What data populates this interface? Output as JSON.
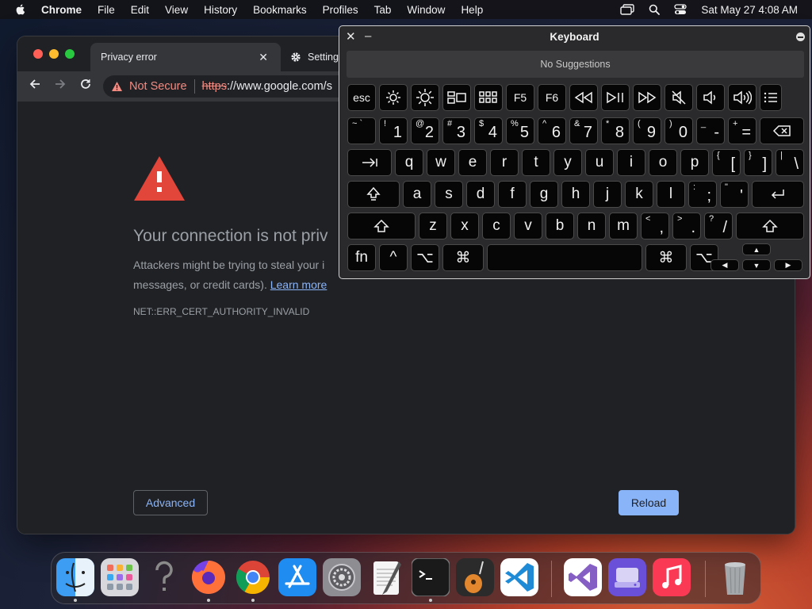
{
  "menubar": {
    "app": "Chrome",
    "items": [
      "File",
      "Edit",
      "View",
      "History",
      "Bookmarks",
      "Profiles",
      "Tab",
      "Window",
      "Help"
    ],
    "datetime": "Sat May 27  4:08 AM"
  },
  "browser": {
    "tab_active_title": "Privacy error",
    "tab_second_title": "Setting",
    "security_chip": "Not Secure",
    "url_scheme": "https",
    "url_rest": "://www.google.com/s"
  },
  "page": {
    "heading": "Your connection is not priv",
    "para_line1": "Attackers might be trying to steal your i",
    "para_line2": "messages, or credit cards).",
    "learn_more": "Learn more",
    "error_code": "NET::ERR_CERT_AUTHORITY_INVALID",
    "advanced_label": "Advanced",
    "reload_label": "Reload"
  },
  "keyboard_viewer": {
    "title": "Keyboard",
    "suggestions": "No Suggestions",
    "rows": [
      [
        {
          "n": "key-esc",
          "l": "esc",
          "w": 36,
          "c": "fnrow"
        },
        {
          "n": "key-brightness-down",
          "i": "sun-small",
          "w": 36
        },
        {
          "n": "key-brightness-up",
          "i": "sun-large",
          "w": 36
        },
        {
          "n": "key-mission-control",
          "i": "mission-control",
          "w": 36
        },
        {
          "n": "key-launchpad",
          "i": "launchpad",
          "w": 36
        },
        {
          "n": "key-f5",
          "l": "F5",
          "w": 36,
          "c": "fnrow"
        },
        {
          "n": "key-f6",
          "l": "F6",
          "w": 36,
          "c": "fnrow"
        },
        {
          "n": "key-rewind",
          "i": "rewind",
          "w": 36
        },
        {
          "n": "key-play-pause",
          "i": "play-pause",
          "w": 36
        },
        {
          "n": "key-fast-forward",
          "i": "fast-forward",
          "w": 36
        },
        {
          "n": "key-mute",
          "i": "mute",
          "w": 36
        },
        {
          "n": "key-volume-down",
          "i": "volume-down",
          "w": 36
        },
        {
          "n": "key-volume-up",
          "i": "volume-up",
          "w": 36
        },
        {
          "n": "key-list",
          "i": "list",
          "w": 28
        }
      ],
      [
        {
          "n": "key-backtick",
          "s": "~ `",
          "w": 36
        },
        {
          "n": "key-1",
          "s": "!",
          "m": "1",
          "w": 36
        },
        {
          "n": "key-2",
          "s": "@",
          "m": "2",
          "w": 36
        },
        {
          "n": "key-3",
          "s": "#",
          "m": "3",
          "w": 36
        },
        {
          "n": "key-4",
          "s": "$",
          "m": "4",
          "w": 36
        },
        {
          "n": "key-5",
          "s": "%",
          "m": "5",
          "w": 36
        },
        {
          "n": "key-6",
          "s": "^",
          "m": "6",
          "w": 36
        },
        {
          "n": "key-7",
          "s": "&",
          "m": "7",
          "w": 36
        },
        {
          "n": "key-8",
          "s": "*",
          "m": "8",
          "w": 36
        },
        {
          "n": "key-9",
          "s": "(",
          "m": "9",
          "w": 36
        },
        {
          "n": "key-0",
          "s": ")",
          "m": "0",
          "w": 36
        },
        {
          "n": "key-minus",
          "s": "_",
          "m": "-",
          "w": 36
        },
        {
          "n": "key-equals",
          "s": "+",
          "m": "=",
          "w": 36
        },
        {
          "n": "key-delete",
          "i": "delete",
          "w": 56
        }
      ],
      [
        {
          "n": "key-tab",
          "i": "tab",
          "w": 56
        },
        {
          "n": "key-q",
          "l": "q",
          "w": 36
        },
        {
          "n": "key-w",
          "l": "w",
          "w": 36
        },
        {
          "n": "key-e",
          "l": "e",
          "w": 36
        },
        {
          "n": "key-r",
          "l": "r",
          "w": 36
        },
        {
          "n": "key-t",
          "l": "t",
          "w": 36
        },
        {
          "n": "key-y",
          "l": "y",
          "w": 36
        },
        {
          "n": "key-u",
          "l": "u",
          "w": 36
        },
        {
          "n": "key-i",
          "l": "i",
          "w": 36
        },
        {
          "n": "key-o",
          "l": "o",
          "w": 36
        },
        {
          "n": "key-p",
          "l": "p",
          "w": 36
        },
        {
          "n": "key-left-bracket",
          "s": "{",
          "m": "[",
          "w": 36
        },
        {
          "n": "key-right-bracket",
          "s": "}",
          "m": "]",
          "w": 36
        },
        {
          "n": "key-backslash",
          "s": "|",
          "m": "\\",
          "w": 36
        }
      ],
      [
        {
          "n": "key-caps-lock",
          "i": "caps",
          "w": 66
        },
        {
          "n": "key-a",
          "l": "a",
          "w": 36
        },
        {
          "n": "key-s",
          "l": "s",
          "w": 36
        },
        {
          "n": "key-d",
          "l": "d",
          "w": 36
        },
        {
          "n": "key-f",
          "l": "f",
          "w": 36
        },
        {
          "n": "key-g",
          "l": "g",
          "w": 36
        },
        {
          "n": "key-h",
          "l": "h",
          "w": 36
        },
        {
          "n": "key-j",
          "l": "j",
          "w": 36
        },
        {
          "n": "key-k",
          "l": "k",
          "w": 36
        },
        {
          "n": "key-l",
          "l": "l",
          "w": 36
        },
        {
          "n": "key-semicolon",
          "s": ":",
          "m": ";",
          "w": 36
        },
        {
          "n": "key-quote",
          "s": "\"",
          "m": "'",
          "w": 36
        },
        {
          "n": "key-return",
          "i": "return",
          "w": 66
        }
      ],
      [
        {
          "n": "key-shift-left",
          "i": "shift",
          "w": 86
        },
        {
          "n": "key-z",
          "l": "z",
          "w": 36
        },
        {
          "n": "key-x",
          "l": "x",
          "w": 36
        },
        {
          "n": "key-c",
          "l": "c",
          "w": 36
        },
        {
          "n": "key-v",
          "l": "v",
          "w": 36
        },
        {
          "n": "key-b",
          "l": "b",
          "w": 36
        },
        {
          "n": "key-n",
          "l": "n",
          "w": 36
        },
        {
          "n": "key-m",
          "l": "m",
          "w": 36
        },
        {
          "n": "key-comma",
          "s": "<",
          "m": ",",
          "w": 36
        },
        {
          "n": "key-period",
          "s": ">",
          "m": ".",
          "w": 36
        },
        {
          "n": "key-slash",
          "s": "?",
          "m": "/",
          "w": 36
        },
        {
          "n": "key-shift-right",
          "i": "shift",
          "w": 86
        }
      ],
      [
        {
          "n": "key-fn",
          "l": "fn",
          "w": 36
        },
        {
          "n": "key-control",
          "l": "^",
          "w": 36
        },
        {
          "n": "key-option-left",
          "l": "⌥",
          "w": 36
        },
        {
          "n": "key-command-left",
          "l": "⌘",
          "w": 52
        },
        {
          "n": "key-space",
          "l": "",
          "w": 196
        },
        {
          "n": "key-command-right",
          "l": "⌘",
          "w": 52
        },
        {
          "n": "key-option-right",
          "l": "⌥",
          "w": 36
        }
      ]
    ],
    "arrows": {
      "up": "▲",
      "left": "◀",
      "down": "▼",
      "right": "▶"
    }
  },
  "dock": {
    "apps": [
      {
        "name": "finder",
        "running": true
      },
      {
        "name": "launchpad",
        "running": false
      },
      {
        "name": "help",
        "running": false
      },
      {
        "name": "firefox",
        "running": true
      },
      {
        "name": "chrome",
        "running": true
      },
      {
        "name": "app-store",
        "running": false
      },
      {
        "name": "system-preferences",
        "running": false
      },
      {
        "name": "textedit",
        "running": false
      },
      {
        "name": "terminal",
        "running": true
      },
      {
        "name": "garageband",
        "running": false
      },
      {
        "name": "vscode",
        "running": false
      },
      {
        "name": "visual-studio",
        "running": false
      },
      {
        "name": "disk-utility",
        "running": false
      },
      {
        "name": "music",
        "running": false
      },
      {
        "name": "trash",
        "running": false
      }
    ]
  }
}
